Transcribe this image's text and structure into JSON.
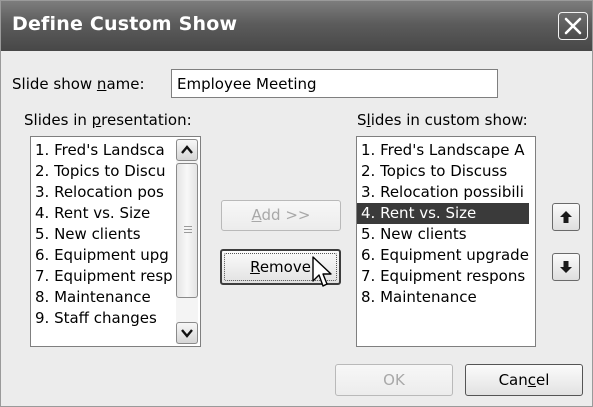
{
  "window": {
    "title": "Define Custom Show"
  },
  "name_field": {
    "label_pre": "Slide show ",
    "label_key": "n",
    "label_post": "ame:",
    "value": "Employee Meeting"
  },
  "presentation_slides": {
    "label_pre": "Slides in ",
    "label_key": "p",
    "label_post": "resentation:",
    "items": [
      "1. Fred's Landsca",
      "2. Topics to Discu",
      "3. Relocation pos",
      "4. Rent vs. Size",
      "5. New clients",
      "6. Equipment upg",
      "7. Equipment resp",
      "8. Maintenance",
      "9. Staff changes"
    ]
  },
  "custom_show_slides": {
    "label_pre": "S",
    "label_key": "l",
    "label_post": "ides in custom show:",
    "selected_index": 3,
    "items": [
      "1. Fred's Landscape A",
      "2. Topics to Discuss",
      "3. Relocation possibili",
      "4. Rent vs. Size",
      "5. New clients",
      "6. Equipment upgrade",
      "7. Equipment respons",
      "8. Maintenance"
    ]
  },
  "buttons": {
    "add_key": "A",
    "add_rest": "dd >>",
    "remove_key": "R",
    "remove_rest": "emove",
    "ok_label": "OK",
    "cancel_pre": "Can",
    "cancel_key": "c",
    "cancel_post": "el"
  },
  "icons": {
    "close": "close-icon",
    "move_up": "arrow-up-icon",
    "move_down": "arrow-down-icon",
    "pointer": "mouse-pointer-icon"
  },
  "state": {
    "add_enabled": false,
    "ok_enabled": false,
    "remove_focused": true
  }
}
